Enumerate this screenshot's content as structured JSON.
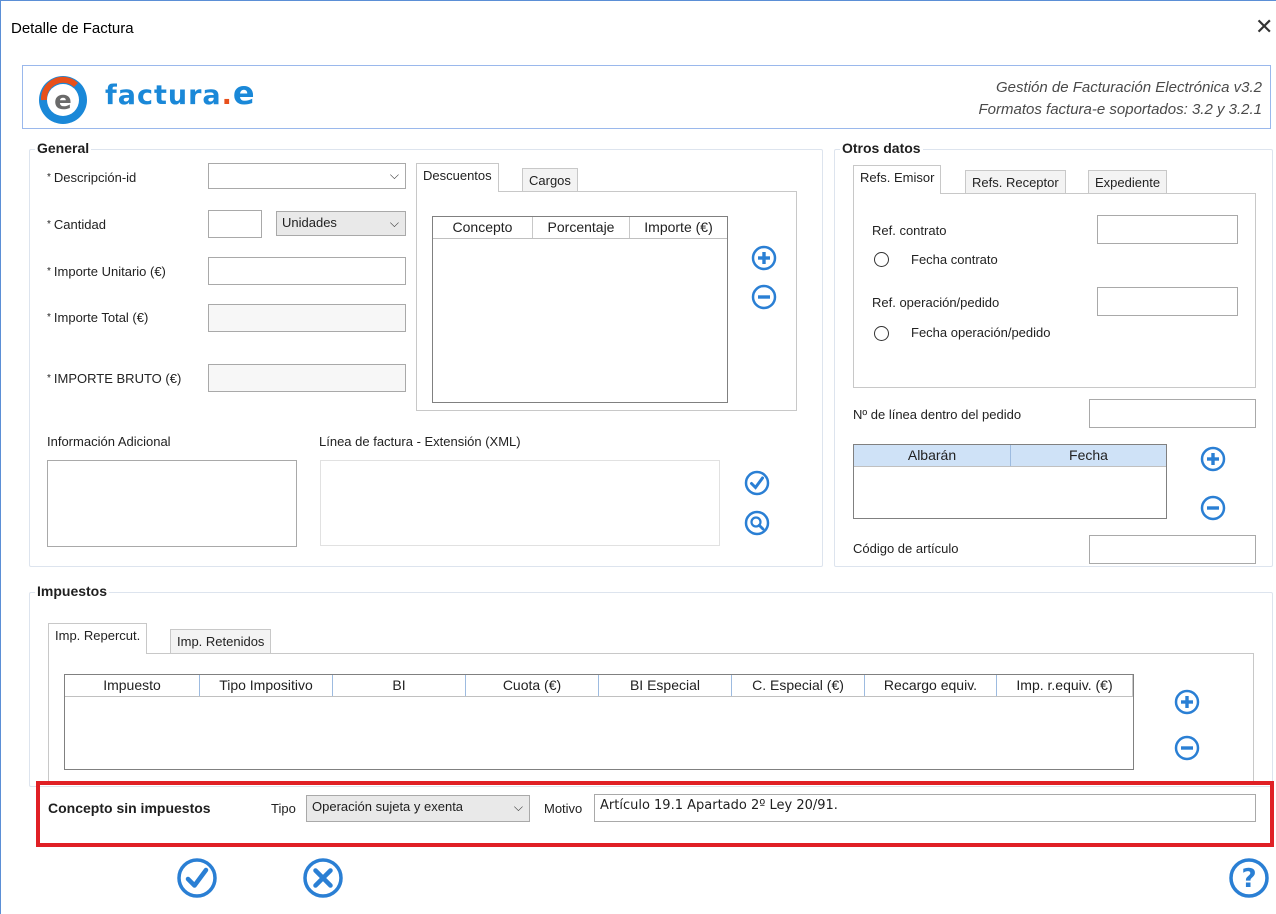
{
  "window": {
    "title": "Detalle de Factura",
    "close_glyph": "✕"
  },
  "banner": {
    "logo_text_main": "factura",
    "logo_dot": ".",
    "logo_e": "e",
    "line1": "Gestión de Facturación Electrónica v3.2",
    "line2": "Formatos factura-e soportados: 3.2 y 3.2.1"
  },
  "general": {
    "title": "General",
    "descripcion_label": "Descripción-id",
    "descripcion_value": "",
    "cantidad_label": "Cantidad",
    "cantidad_value": "",
    "unidades_value": "Unidades",
    "importe_unitario_label": "Importe Unitario (€)",
    "importe_unitario_value": "",
    "importe_total_label": "Importe Total (€)",
    "importe_total_value": "",
    "importe_bruto_label": "IMPORTE BRUTO (€)",
    "importe_bruto_value": "",
    "required_mark": "*",
    "info_adicional_label": "Información Adicional",
    "linea_extension_label": "Línea de factura - Extensión (XML)",
    "tabs": [
      {
        "label": "Descuentos"
      },
      {
        "label": "Cargos"
      }
    ],
    "descuentos_columns": [
      "Concepto",
      "Porcentaje",
      "Importe (€)"
    ]
  },
  "otros": {
    "title": "Otros datos",
    "tabs": [
      {
        "label": "Refs. Emisor"
      },
      {
        "label": "Refs. Receptor"
      },
      {
        "label": "Expediente"
      }
    ],
    "ref_contrato_label": "Ref. contrato",
    "ref_contrato_value": "",
    "fecha_contrato_label": "Fecha contrato",
    "ref_operacion_label": "Ref. operación/pedido",
    "ref_operacion_value": "",
    "fecha_operacion_label": "Fecha operación/pedido",
    "n_linea_label": "Nº de línea dentro del pedido",
    "n_linea_value": "",
    "albaran_columns": [
      "Albarán",
      "Fecha"
    ],
    "codigo_articulo_label": "Código de artículo",
    "codigo_articulo_value": ""
  },
  "impuestos": {
    "title": "Impuestos",
    "tabs": [
      {
        "label": "Imp. Repercut."
      },
      {
        "label": "Imp. Retenidos"
      }
    ],
    "columns": [
      "Impuesto",
      "Tipo Impositivo",
      "BI",
      "Cuota (€)",
      "BI Especial",
      "C. Especial (€)",
      "Recargo equiv.",
      "Imp. r.equiv. (€)"
    ]
  },
  "concepto": {
    "label": "Concepto sin impuestos",
    "tipo_label": "Tipo",
    "tipo_value": "Operación sujeta y exenta",
    "motivo_label": "Motivo",
    "motivo_value": "Artículo 19.1 Apartado 2º Ley 20/91."
  },
  "colors": {
    "accent": "#1a88d8",
    "highlight": "#e02025",
    "icon_blue": "#2a7fd4"
  }
}
